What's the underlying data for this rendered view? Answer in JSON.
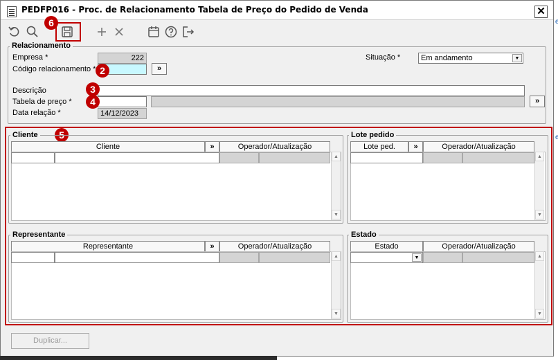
{
  "window": {
    "title": "PEDFP016 - Proc. de Relacionamento Tabela de Preço do Pedido de Venda",
    "close_label": "✕"
  },
  "toolbar": {
    "icons": [
      "undo-icon",
      "search-icon",
      "save-icon",
      "add-icon",
      "delete-icon",
      "calendar-icon",
      "help-icon",
      "exit-icon"
    ]
  },
  "badges": {
    "b2": "2",
    "b3": "3",
    "b4": "4",
    "b5": "5",
    "b6": "6"
  },
  "relacionamento": {
    "legend": "Relacionamento",
    "empresa_label": "Empresa *",
    "empresa_value": "222",
    "codigo_label": "Código relacionamento *",
    "codigo_value": "",
    "situacao_label": "Situação *",
    "situacao_value": "Em andamento",
    "descricao_label": "Descrição",
    "descricao_value": "",
    "tabela_label": "Tabela de preço *",
    "tabela_value": "",
    "tabela_desc_value": "",
    "data_label": "Data relação *",
    "data_value": "14/12/2023",
    "lookup_label": "»"
  },
  "cliente": {
    "legend": "Cliente",
    "columns": [
      "Cliente",
      "»",
      "Operador/Atualização"
    ]
  },
  "lote": {
    "legend": "Lote pedido",
    "columns": [
      "Lote ped.",
      "»",
      "Operador/Atualização"
    ]
  },
  "representante": {
    "legend": "Representante",
    "columns": [
      "Representante",
      "»",
      "Operador/Atualização"
    ]
  },
  "estado": {
    "legend": "Estado",
    "columns": [
      "Estado",
      "Operador/Atualização"
    ]
  },
  "footer": {
    "duplicar_label": "Duplicar..."
  },
  "edge": {
    "e1": "e",
    "e2": "e"
  },
  "colors": {
    "highlight_red": "#c00000",
    "required_field": "#c8f8ff",
    "readonly_field": "#d4d4d4"
  }
}
